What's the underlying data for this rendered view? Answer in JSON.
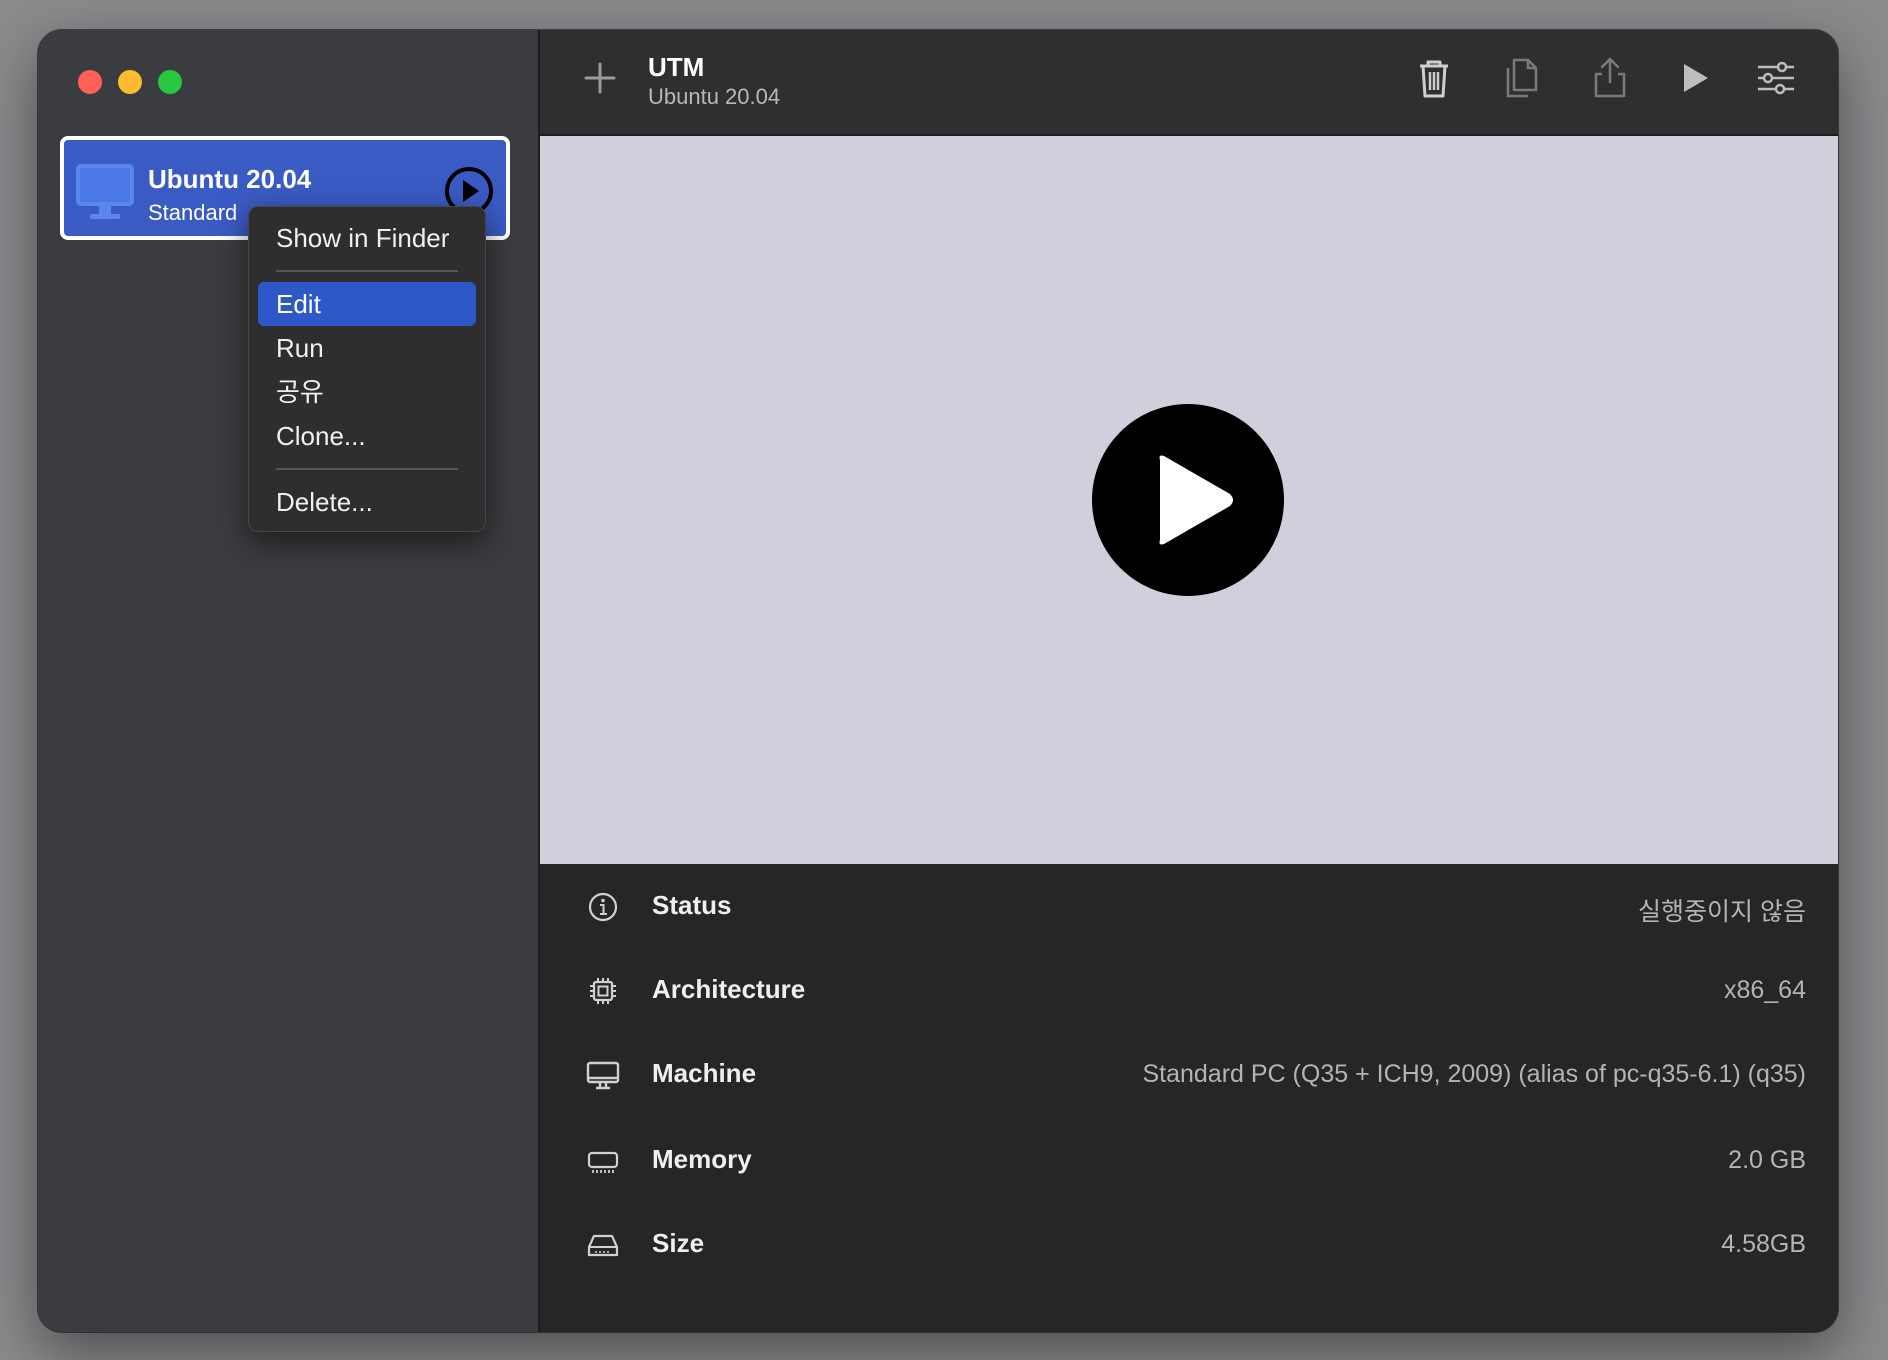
{
  "sidebar": {
    "vm": {
      "name": "Ubuntu 20.04",
      "subtitle": "Standard"
    }
  },
  "context_menu": {
    "items": [
      {
        "label": "Show in Finder"
      },
      {
        "label": "Edit"
      },
      {
        "label": "Run"
      },
      {
        "label": "공유"
      },
      {
        "label": "Clone..."
      },
      {
        "label": "Delete..."
      }
    ],
    "highlighted": "Edit"
  },
  "toolbar": {
    "title": "UTM",
    "subtitle": "Ubuntu 20.04",
    "icons": [
      "plus-icon",
      "trash-icon",
      "clone-icon",
      "share-icon",
      "play-icon",
      "settings-icon"
    ]
  },
  "details": {
    "status": {
      "label": "Status",
      "value": "실행중이지 않음"
    },
    "architecture": {
      "label": "Architecture",
      "value": "x86_64"
    },
    "machine": {
      "label": "Machine",
      "value": "Standard PC (Q35 + ICH9, 2009) (alias of pc-q35-6.1) (q35)"
    },
    "memory": {
      "label": "Memory",
      "value": "2.0 GB"
    },
    "size": {
      "label": "Size",
      "value": "4.58GB"
    }
  },
  "colors": {
    "accent": "#3b5bc4",
    "menu_highlight": "#2d58c7",
    "preview_bg": "#d1cfdb"
  }
}
